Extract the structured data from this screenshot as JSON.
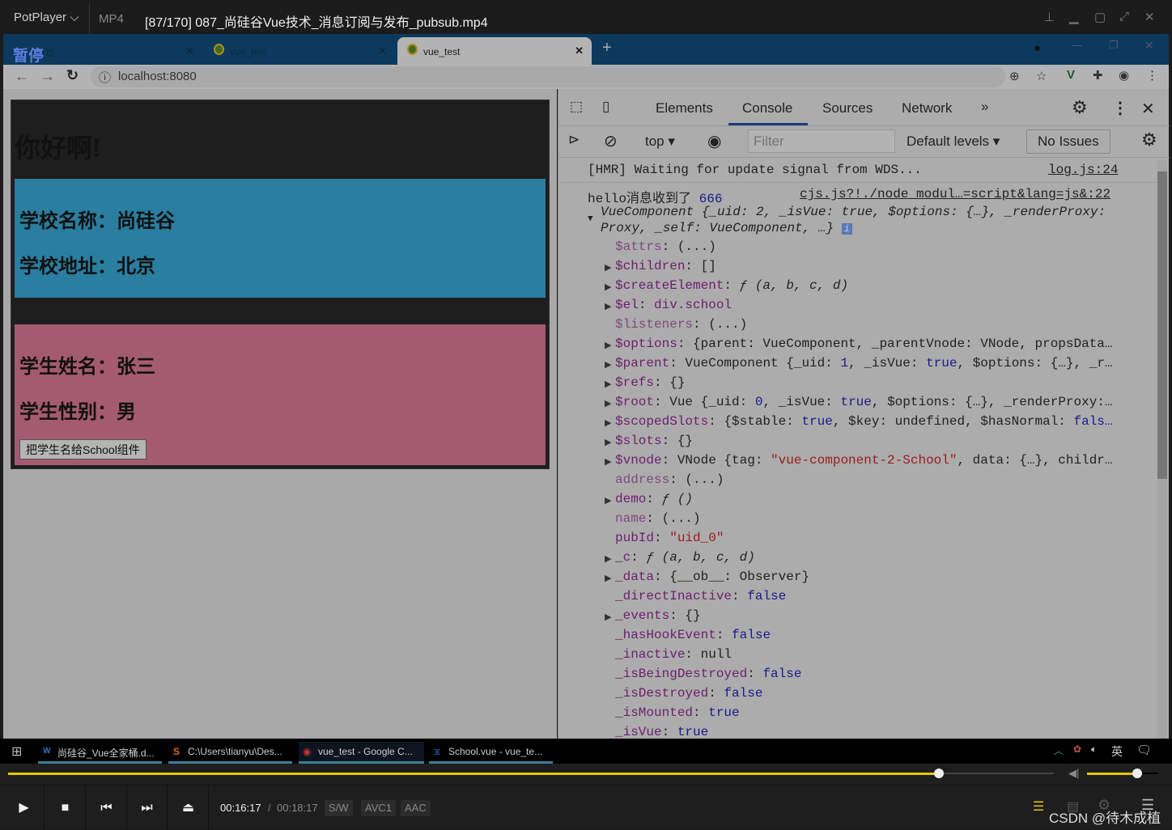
{
  "player": {
    "brand": "PotPlayer",
    "format": "MP4",
    "title": "[87/170] 087_尚硅谷Vue技术_消息订阅与发布_pubsub.mp4",
    "paused_label": "暂停",
    "time_current": "00:16:17",
    "time_total": "00:18:17",
    "badges": [
      "S/W",
      "AVC1",
      "AAC"
    ],
    "progress_percent": 89,
    "volume_percent": 70,
    "watermark": "CSDN @待木成植",
    "accent": "#e6c800"
  },
  "browser": {
    "tabs": [
      {
        "label": "新标签页"
      },
      {
        "label": "vue_test"
      },
      {
        "label": "vue_test",
        "active": true
      }
    ],
    "url": "localhost:8080"
  },
  "page": {
    "heading": "你好啊!",
    "school_name": "学校名称：尚硅谷",
    "school_address": "学校地址：北京",
    "student_name": "学生姓名：张三",
    "student_sex": "学生性别：男",
    "send_button": "把学生名给School组件",
    "colors": {
      "school_bg": "#2a7e9f",
      "student_bg": "#a55b6f"
    }
  },
  "devtools": {
    "tabs": [
      "Elements",
      "Console",
      "Sources",
      "Network"
    ],
    "active_tab": "Console",
    "context": "top",
    "filter_placeholder": "Filter",
    "levels": "Default levels",
    "issues": "No Issues",
    "log1": {
      "text": "[HMR] Waiting for update signal from WDS...",
      "source": "log.js:24"
    },
    "log2": {
      "text": "hello消息收到了",
      "num": "666",
      "source": "cjs.js?!./node_modul…=script&lang=js&:22"
    },
    "object_summary_1": "VueComponent {_uid: 2, _isVue: true, $options: {…}, _renderProxy:",
    "object_summary_2": "Proxy, _self: VueComponent, …}",
    "props": [
      {
        "a": false,
        "k": "$attrs",
        "d": true,
        "v": [
          [
            "(...)",
            ""
          ]
        ]
      },
      {
        "a": true,
        "k": "$children",
        "v": [
          [
            "[]",
            ""
          ]
        ]
      },
      {
        "a": true,
        "k": "$createElement",
        "v": [
          [
            "ƒ (a, b, c, d)",
            "i"
          ]
        ]
      },
      {
        "a": true,
        "k": "$el",
        "v": [
          [
            "div.school",
            "k"
          ]
        ]
      },
      {
        "a": false,
        "k": "$listeners",
        "d": true,
        "v": [
          [
            "(...)",
            ""
          ]
        ]
      },
      {
        "a": true,
        "k": "$options",
        "v": [
          [
            "{parent: VueComponent, _parentVnode: VNode, propsData…",
            ""
          ]
        ]
      },
      {
        "a": true,
        "k": "$parent",
        "v": [
          [
            "VueComponent {_uid: ",
            ""
          ],
          [
            "1",
            "n"
          ],
          [
            ", _isVue: ",
            ""
          ],
          [
            "true",
            "b"
          ],
          [
            ", $options: {…}, _r…",
            ""
          ]
        ]
      },
      {
        "a": true,
        "k": "$refs",
        "v": [
          [
            "{}",
            ""
          ]
        ]
      },
      {
        "a": true,
        "k": "$root",
        "v": [
          [
            "Vue {_uid: ",
            ""
          ],
          [
            "0",
            "n"
          ],
          [
            ", _isVue: ",
            ""
          ],
          [
            "true",
            "b"
          ],
          [
            ", $options: {…}, _renderProxy:…",
            ""
          ]
        ]
      },
      {
        "a": true,
        "k": "$scopedSlots",
        "v": [
          [
            "{$stable: ",
            ""
          ],
          [
            "true",
            "b"
          ],
          [
            ", $key: undefined, $hasNormal: ",
            ""
          ],
          [
            "fals…",
            "b"
          ]
        ]
      },
      {
        "a": true,
        "k": "$slots",
        "v": [
          [
            "{}",
            ""
          ]
        ]
      },
      {
        "a": true,
        "k": "$vnode",
        "v": [
          [
            "VNode {tag: ",
            ""
          ],
          [
            "\"vue-component-2-School\"",
            "s"
          ],
          [
            ", data: {…}, childr…",
            ""
          ]
        ]
      },
      {
        "a": false,
        "k": "address",
        "d": true,
        "v": [
          [
            "(...)",
            ""
          ]
        ]
      },
      {
        "a": true,
        "k": "demo",
        "v": [
          [
            "ƒ ()",
            "i"
          ]
        ]
      },
      {
        "a": false,
        "k": "name",
        "d": true,
        "v": [
          [
            "(...)",
            ""
          ]
        ]
      },
      {
        "a": false,
        "k": "pubId",
        "v": [
          [
            "\"uid_0\"",
            "s"
          ]
        ]
      },
      {
        "a": true,
        "k": "_c",
        "v": [
          [
            "ƒ (a, b, c, d)",
            "i"
          ]
        ]
      },
      {
        "a": true,
        "k": "_data",
        "v": [
          [
            "{__ob__: Observer}",
            ""
          ]
        ]
      },
      {
        "a": false,
        "k": "_directInactive",
        "v": [
          [
            "false",
            "b"
          ]
        ]
      },
      {
        "a": true,
        "k": "_events",
        "v": [
          [
            "{}",
            ""
          ]
        ]
      },
      {
        "a": false,
        "k": "_hasHookEvent",
        "v": [
          [
            "false",
            "b"
          ]
        ]
      },
      {
        "a": false,
        "k": "_inactive",
        "v": [
          [
            "null",
            ""
          ]
        ]
      },
      {
        "a": false,
        "k": "_isBeingDestroyed",
        "v": [
          [
            "false",
            "b"
          ]
        ]
      },
      {
        "a": false,
        "k": "_isDestroyed",
        "v": [
          [
            "false",
            "b"
          ]
        ]
      },
      {
        "a": false,
        "k": "_isMounted",
        "v": [
          [
            "true",
            "b"
          ]
        ]
      },
      {
        "a": false,
        "k": "_isVue",
        "v": [
          [
            "true",
            "b"
          ]
        ]
      }
    ]
  },
  "taskbar": {
    "items": [
      "尚硅谷_Vue全家桶.d...",
      "C:\\Users\\tianyu\\Des...",
      "vue_test - Google C...",
      "School.vue - vue_te..."
    ],
    "ime": "英"
  }
}
